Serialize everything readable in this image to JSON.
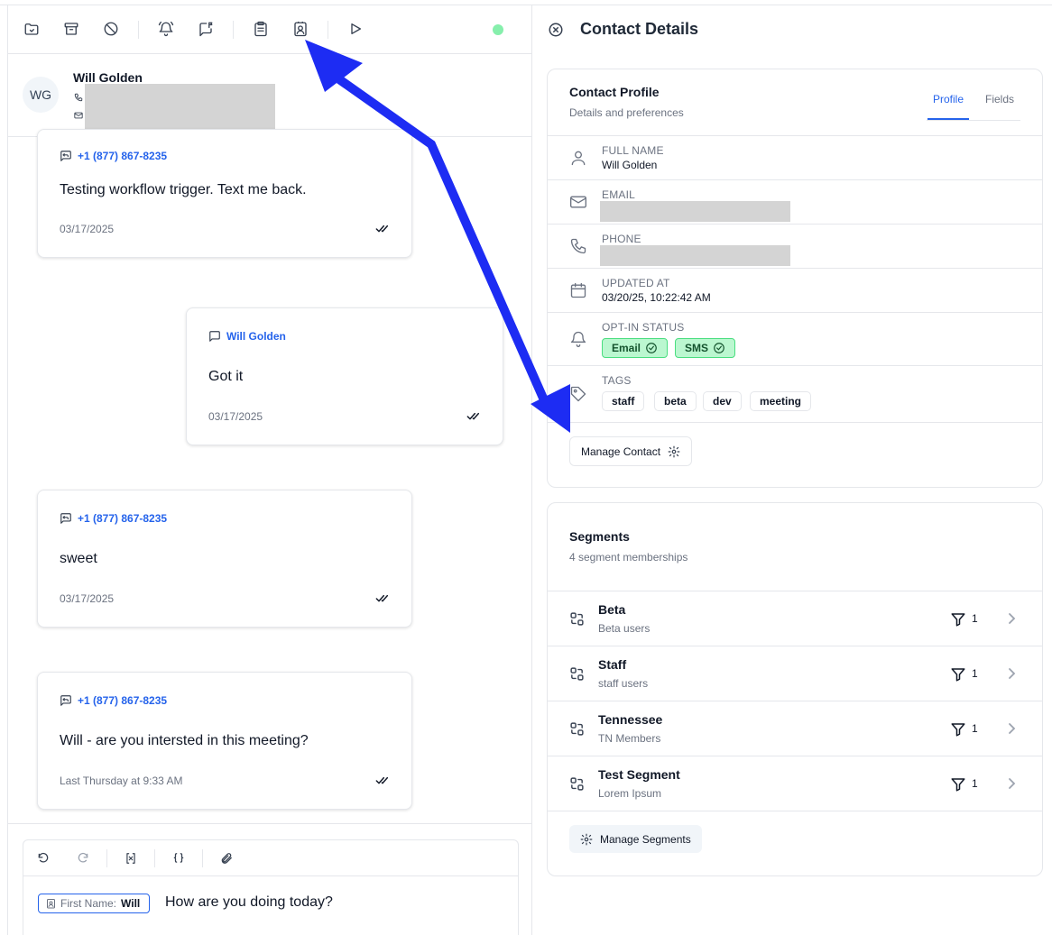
{
  "toolbar": {
    "icons": [
      "folder-check-icon",
      "archive-icon",
      "block-icon",
      "bell-ring-icon",
      "message-flag-icon",
      "clipboard-icon",
      "contact-card-icon",
      "play-icon"
    ],
    "status_color": "#86efac"
  },
  "contact": {
    "initials": "WG",
    "name": "Will Golden"
  },
  "messages": [
    {
      "from": "+1 (877) 867-8235",
      "text": "Testing workflow trigger. Text me back.",
      "date": "03/17/2025",
      "direction": "outbound"
    },
    {
      "from": "Will Golden",
      "text": "Got it",
      "date": "03/17/2025",
      "direction": "inbound"
    },
    {
      "from": "+1 (877) 867-8235",
      "text": "sweet",
      "date": "03/17/2025",
      "direction": "outbound"
    },
    {
      "from": "+1 (877) 867-8235",
      "text": "Will - are you intersted in this meeting?",
      "date": "Last Thursday at 9:33 AM",
      "direction": "outbound"
    }
  ],
  "composer": {
    "icons": [
      "undo-icon",
      "redo-icon",
      "variable-icon",
      "braces-icon",
      "paperclip-icon"
    ],
    "chip_label": "First Name:",
    "chip_value": "Will",
    "text": "How are you doing today?"
  },
  "details": {
    "title": "Contact Details",
    "profile_card": {
      "title": "Contact Profile",
      "subtitle": "Details and preferences",
      "tabs": [
        "Profile",
        "Fields"
      ],
      "active_tab": "Profile",
      "full_name_label": "FULL NAME",
      "full_name": "Will Golden",
      "email_label": "EMAIL",
      "phone_label": "PHONE",
      "updated_label": "UPDATED AT",
      "updated": "03/20/25, 10:22:42 AM",
      "optin_label": "OPT-IN STATUS",
      "optin": [
        "Email",
        "SMS"
      ],
      "tags_label": "TAGS",
      "tags": [
        "staff",
        "beta",
        "dev",
        "meeting"
      ],
      "manage_button": "Manage Contact"
    },
    "segments_card": {
      "title": "Segments",
      "subtitle": "4 segment memberships",
      "items": [
        {
          "name": "Beta",
          "description": "Beta users",
          "count": "1"
        },
        {
          "name": "Staff",
          "description": "staff users",
          "count": "1"
        },
        {
          "name": "Tennessee",
          "description": "TN Members",
          "count": "1"
        },
        {
          "name": "Test Segment",
          "description": "Lorem Ipsum",
          "count": "1"
        }
      ],
      "manage_button": "Manage Segments"
    }
  },
  "colors": {
    "accent": "#2563eb",
    "annotation_arrow": "#1d2cf3",
    "optin_green": "#bbf7d0"
  }
}
